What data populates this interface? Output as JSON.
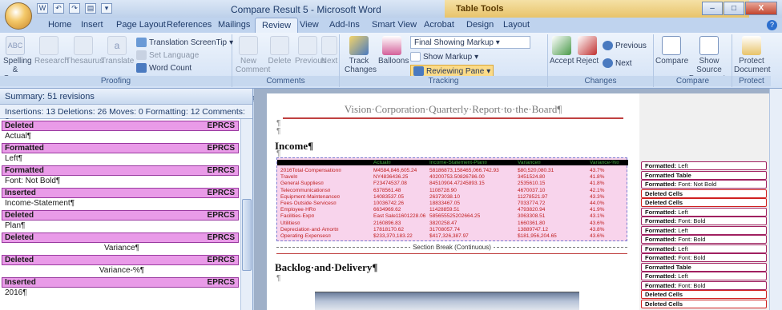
{
  "window": {
    "title": "Compare Result 5 - Microsoft Word",
    "context_tab": "Table Tools",
    "controls": {
      "minimize": "–",
      "maximize": "□",
      "close": "X"
    }
  },
  "tabs": [
    {
      "label": "Home"
    },
    {
      "label": "Insert"
    },
    {
      "label": "Page Layout"
    },
    {
      "label": "References"
    },
    {
      "label": "Mailings"
    },
    {
      "label": "Review"
    },
    {
      "label": "View"
    },
    {
      "label": "Add-Ins"
    },
    {
      "label": "Smart View"
    },
    {
      "label": "Acrobat"
    },
    {
      "label": "Design"
    },
    {
      "label": "Layout"
    }
  ],
  "ribbon": {
    "proofing": {
      "label": "Proofing",
      "spelling": "Spelling & Grammar",
      "research": "Research",
      "thesaurus": "Thesaurus",
      "translate": "Translate",
      "translation_screentip": "Translation ScreenTip",
      "set_language": "Set Language",
      "word_count": "Word Count"
    },
    "comments": {
      "label": "Comments",
      "new": "New Comment",
      "delete": "Delete",
      "previous": "Previous",
      "next": "Next"
    },
    "tracking": {
      "label": "Tracking",
      "track_changes": "Track Changes",
      "balloons": "Balloons",
      "final_showing_markup": "Final Showing Markup",
      "show_markup": "Show Markup",
      "reviewing_pane": "Reviewing Pane"
    },
    "changes": {
      "label": "Changes",
      "accept": "Accept",
      "reject": "Reject",
      "previous": "Previous",
      "next": "Next"
    },
    "compare": {
      "label": "Compare",
      "compare": "Compare",
      "show_source": "Show Source Documents"
    },
    "protect": {
      "label": "Protect",
      "protect_document": "Protect Document"
    }
  },
  "reviewing_pane": {
    "summary": "Summary: 51 revisions",
    "counts": "Insertions: 13  Deletions: 26  Moves: 0  Formatting: 12  Comments: 0",
    "revisions": [
      {
        "type": "Deleted",
        "author": "EPRCS",
        "text": "Actual¶"
      },
      {
        "type": "Formatted",
        "author": "EPRCS",
        "text": "Left¶"
      },
      {
        "type": "Formatted",
        "author": "EPRCS",
        "text": "Font: Not Bold¶"
      },
      {
        "type": "Inserted",
        "author": "EPRCS",
        "text": "Income-Statement¶"
      },
      {
        "type": "Deleted",
        "author": "EPRCS",
        "text": "Plan¶"
      },
      {
        "type": "Deleted",
        "author": "EPRCS",
        "text": "Variance¶"
      },
      {
        "type": "Deleted",
        "author": "EPRCS",
        "text": "Variance-%¶"
      },
      {
        "type": "Inserted",
        "author": "EPRCS",
        "text": "2016¶"
      }
    ]
  },
  "document": {
    "title": "Vision·Corporation·Quarterly·Report·to·the·Board¶",
    "pilcrow": "¶",
    "heading_income": "Income¶",
    "heading_backlog": "Backlog·and·Delivery¶",
    "section_break": "Section Break (Continuous)",
    "table_header": [
      "Actual¤",
      "Income-Statement-Plan¤",
      "Variance¤",
      "Variance-%¤"
    ],
    "table_rows": [
      [
        "2016Total·Compensation¤",
        "M4584,846,605.24",
        "58186873,158465,066.742.93",
        "$80,520,080.31",
        "43.7%"
      ],
      [
        "Travel¤",
        "NY4836436.25",
        "40200753.50826786.00",
        "3451524.80",
        "41.8%"
      ],
      [
        "General·Supplies¤",
        "F23474537.08",
        "84510904.47245893.15",
        "2535610.15",
        "41.8%"
      ],
      [
        "Telecommunications¤",
        "6378561.48",
        "1108728.90",
        "4670037.10",
        "42.1%"
      ],
      [
        "Equipment·Maintenance¤",
        "14083537.05",
        "26373038.10",
        "11278521.97",
        "43.3%"
      ],
      [
        "Fees·Outside·Services¤",
        "10036742.26",
        "18833467.05",
        "7033774.72",
        "44.0%"
      ],
      [
        "Employee·HR¤",
        "6634969.62",
        "11428859.51",
        "4793820.94",
        "41.9%"
      ],
      [
        "Facilities·Exp¤",
        "East Sale11601228.06",
        "585655525202664.25",
        "3063308.51",
        "43.1%"
      ],
      [
        "Utilities¤",
        "2160896.83",
        "3820258.47",
        "1660361.80",
        "43.6%"
      ],
      [
        "Depreciation·and·Amort¤",
        "17818170.62",
        "31708057.74",
        "13889747.12",
        "43.8%"
      ],
      [
        "Operating·Expenses¤",
        "$233,370,183.22",
        "$417,326,387.97",
        "$181,956,204.65",
        "43.6%"
      ]
    ]
  },
  "balloons": [
    {
      "label": "Formatted:",
      "detail": "Left",
      "kind": "fmt"
    },
    {
      "label": "Formatted Table",
      "detail": "",
      "kind": "fmt"
    },
    {
      "label": "Formatted:",
      "detail": "Font: Not Bold",
      "kind": "fmt"
    },
    {
      "label": "Deleted Cells",
      "detail": "",
      "kind": "del"
    },
    {
      "label": "Deleted Cells",
      "detail": "",
      "kind": "del"
    },
    {
      "label": "Formatted:",
      "detail": "Left",
      "kind": "fmt"
    },
    {
      "label": "Formatted:",
      "detail": "Font: Bold",
      "kind": "fmt"
    },
    {
      "label": "Formatted:",
      "detail": "Left",
      "kind": "fmt"
    },
    {
      "label": "Formatted:",
      "detail": "Font: Bold",
      "kind": "fmt"
    },
    {
      "label": "Formatted:",
      "detail": "Left",
      "kind": "fmt"
    },
    {
      "label": "Formatted:",
      "detail": "Font: Bold",
      "kind": "fmt"
    },
    {
      "label": "Formatted Table",
      "detail": "",
      "kind": "fmt"
    },
    {
      "label": "Formatted:",
      "detail": "Left",
      "kind": "fmt"
    },
    {
      "label": "Formatted:",
      "detail": "Font: Bold",
      "kind": "fmt"
    },
    {
      "label": "Deleted Cells",
      "detail": "",
      "kind": "del"
    },
    {
      "label": "Deleted Cells",
      "detail": "",
      "kind": "del"
    }
  ],
  "colors": {
    "revision_header": "#e99be8",
    "deleted": "#c02020",
    "accent": "#2d6fce"
  }
}
